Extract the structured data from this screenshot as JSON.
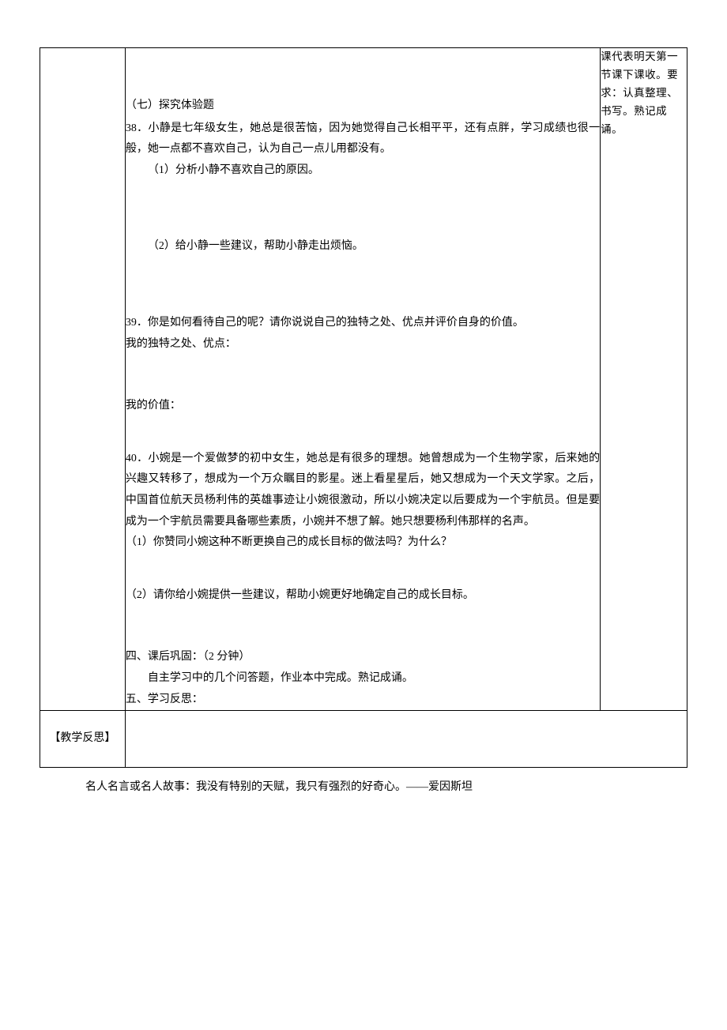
{
  "sidebar_note": "课代表明天第一节课下课收。要求：认真整理、书写。熟记成诵。",
  "section7": {
    "heading": "（七）探究体验题",
    "q38": {
      "stem": "38．小静是七年级女生，她总是很苦恼，因为她觉得自己长相平平，还有点胖，学习成绩也很一般，她一点都不喜欢自己，认为自己一点儿用都没有。",
      "sub1": "（1）分析小静不喜欢自己的原因。",
      "sub2": "（2）给小静一些建议，帮助小静走出烦恼。"
    },
    "q39": {
      "stem": "39．你是如何看待自己的呢？请你说说自己的独特之处、优点并评价自身的价值。",
      "line1": "我的独特之处、优点：",
      "line2": "我的价值："
    },
    "q40": {
      "stem": "40．小婉是一个爱做梦的初中女生，她总是有很多的理想。她曾想成为一个生物学家，后来她的兴趣又转移了，想成为一个万众瞩目的影星。迷上看星星后，她又想成为一个天文学家。之后，中国首位航天员杨利伟的英雄事迹让小婉很激动，所以小婉决定以后要成为一个宇航员。但是要成为一个宇航员需要具备哪些素质，小婉并不想了解。她只想要杨利伟那样的名声。",
      "sub1": "（1）你赞同小婉这种不断更换自己的成长目标的做法吗？为什么？",
      "sub2": "（2）请你给小婉提供一些建议，帮助小婉更好地确定自己的成长目标。"
    },
    "part4": {
      "heading": "四、课后巩固：（2 分钟）",
      "body": "自主学习中的几个问答题，作业本中完成。熟记成诵。"
    },
    "part5": {
      "heading": "五、学习反思："
    }
  },
  "reflection_label": "【教学反思】",
  "footer_quote": "名人名言或名人故事：我没有特别的天赋，我只有强烈的好奇心。——爱因斯坦"
}
